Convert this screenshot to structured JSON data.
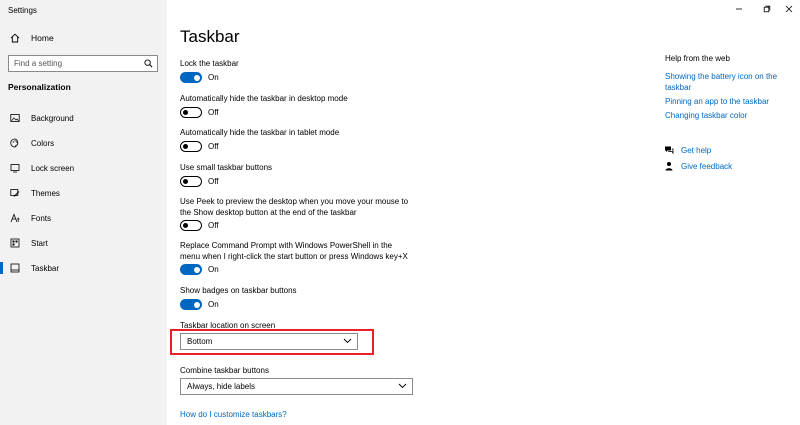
{
  "window": {
    "app_title": "Settings"
  },
  "sidebar": {
    "home_label": "Home",
    "search_placeholder": "Find a setting",
    "section_label": "Personalization",
    "items": [
      {
        "label": "Background",
        "icon": "image-icon"
      },
      {
        "label": "Colors",
        "icon": "palette-icon"
      },
      {
        "label": "Lock screen",
        "icon": "lock-screen-icon"
      },
      {
        "label": "Themes",
        "icon": "brush-icon"
      },
      {
        "label": "Fonts",
        "icon": "font-icon"
      },
      {
        "label": "Start",
        "icon": "start-icon"
      },
      {
        "label": "Taskbar",
        "icon": "taskbar-icon",
        "selected": true
      }
    ]
  },
  "main": {
    "title": "Taskbar",
    "settings": [
      {
        "label": "Lock the taskbar",
        "state": "On"
      },
      {
        "label": "Automatically hide the taskbar in desktop mode",
        "state": "Off"
      },
      {
        "label": "Automatically hide the taskbar in tablet mode",
        "state": "Off"
      },
      {
        "label": "Use small taskbar buttons",
        "state": "Off"
      },
      {
        "label": "Use Peek to preview the desktop when you move your mouse to the Show desktop button at the end of the taskbar",
        "state": "Off"
      },
      {
        "label": "Replace Command Prompt with Windows PowerShell in the menu when I right-click the start button or press Windows key+X",
        "state": "On"
      },
      {
        "label": "Show badges on taskbar buttons",
        "state": "On"
      }
    ],
    "location": {
      "label": "Taskbar location on screen",
      "value": "Bottom"
    },
    "combine": {
      "label": "Combine taskbar buttons",
      "value": "Always, hide labels"
    },
    "help_link": "How do I customize taskbars?"
  },
  "help_panel": {
    "title": "Help from the web",
    "links": [
      "Showing the battery icon on the taskbar",
      "Pinning an app to the taskbar",
      "Changing taskbar color"
    ],
    "get_help": "Get help",
    "give_feedback": "Give feedback"
  },
  "colors": {
    "accent": "#0067c0",
    "highlight": "#e8202a",
    "sidebar_bg": "#f2f2f2"
  }
}
